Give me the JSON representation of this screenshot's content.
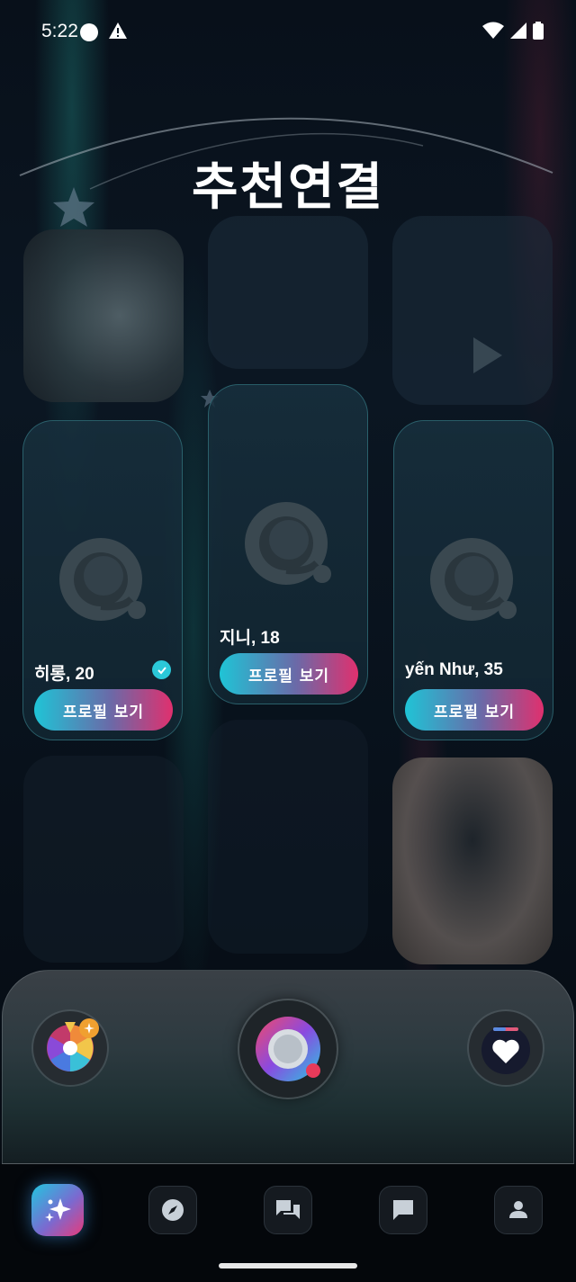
{
  "status_bar": {
    "time": "5:22"
  },
  "header": {
    "title": "추천연결"
  },
  "cards": [
    {
      "name": "히롱, 20",
      "verified": true,
      "button_label": "프로필 보기"
    },
    {
      "name": "지니, 18",
      "verified": false,
      "button_label": "프로필 보기"
    },
    {
      "name": "yến Như, 35",
      "verified": false,
      "button_label": "프로필 보기"
    }
  ],
  "dock": {
    "left_icon": "wheel-badge-icon",
    "center_icon": "search-logo-icon",
    "right_icon": "heart-icon"
  },
  "bottom_nav": [
    {
      "icon": "sparkle-icon",
      "active": true
    },
    {
      "icon": "compass-icon",
      "active": false
    },
    {
      "icon": "chat-bubbles-icon",
      "active": false
    },
    {
      "icon": "message-icon",
      "active": false
    },
    {
      "icon": "person-icon",
      "active": false
    }
  ],
  "colors": {
    "accent_cyan": "#1fc4d6",
    "accent_pink": "#e0306e",
    "background": "#060c14"
  }
}
